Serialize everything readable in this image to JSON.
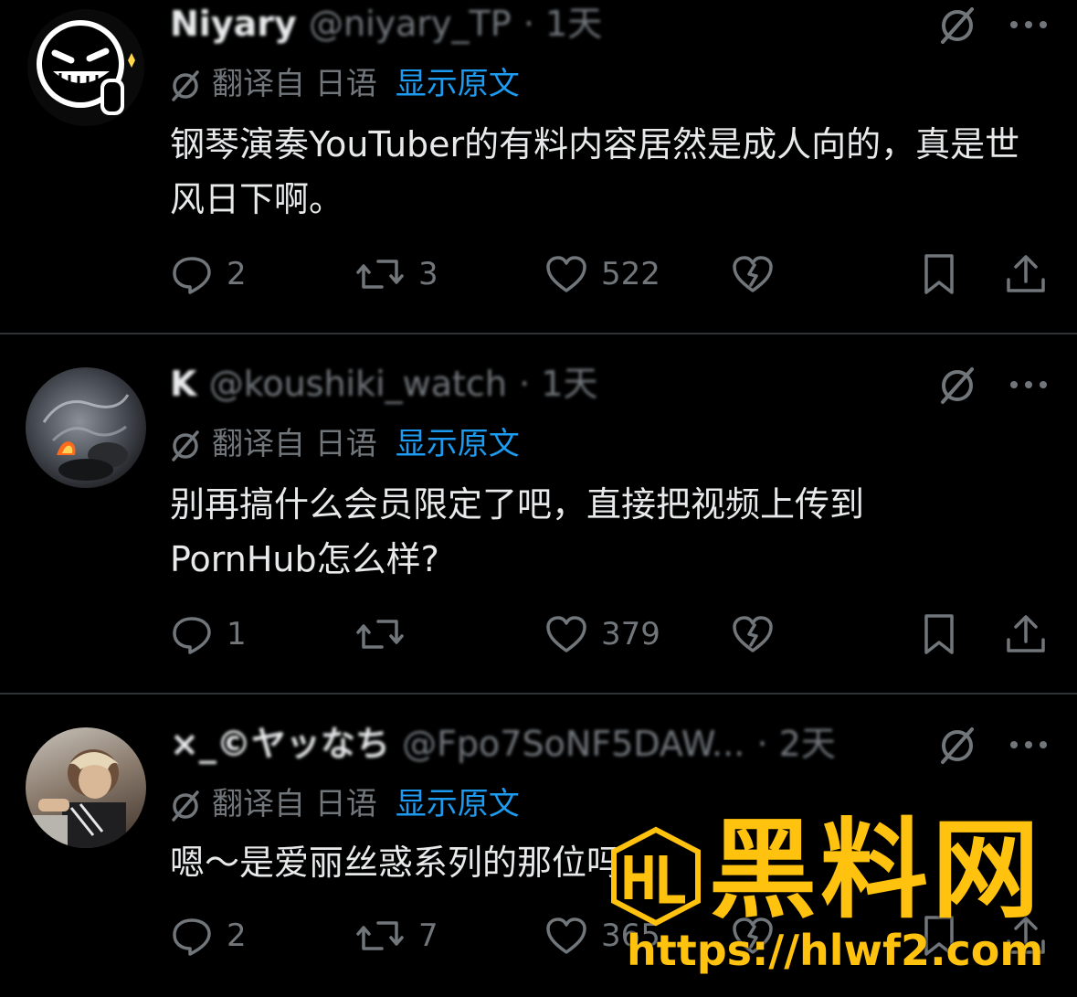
{
  "posts": [
    {
      "name": "Niyary",
      "handle": "@niyary_TP",
      "time": "· 1天",
      "translate_prefix": "翻译自 日语",
      "show_original": "显示原文",
      "text": "钢琴演奏YouTuber的有料内容居然是成人向的，真是世风日下啊。",
      "replies": "2",
      "reposts": "3",
      "likes": "522"
    },
    {
      "name": "K",
      "handle": "@koushiki_watch",
      "time": "· 1天",
      "translate_prefix": "翻译自 日语",
      "show_original": "显示原文",
      "text": "别再搞什么会员限定了吧，直接把视频上传到PornHub怎么样?",
      "replies": "1",
      "reposts": "",
      "likes": "379"
    },
    {
      "name": "×_©ヤッなち",
      "handle": "@Fpo7SoNF5DAW...",
      "time": "· 2天",
      "translate_prefix": "翻译自 日语",
      "show_original": "显示原文",
      "text": "嗯～是爱丽丝惑系列的那位吗?",
      "replies": "2",
      "reposts": "7",
      "likes": "365"
    }
  ],
  "watermark": {
    "title": "黑料网",
    "url": "https://hlwf2.com",
    "logo_text": "HL"
  },
  "colors": {
    "background": "#000000",
    "text": "#e7e9ea",
    "muted": "#71767b",
    "link": "#1d9bf0",
    "watermark": "#ffc20e"
  }
}
